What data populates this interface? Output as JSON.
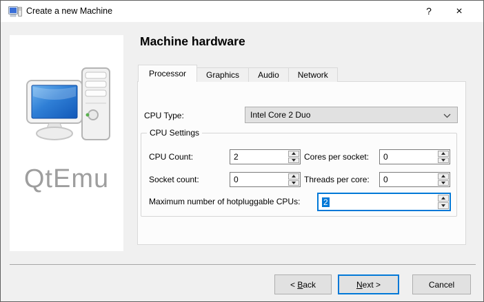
{
  "window": {
    "title": "Create a new Machine",
    "help_glyph": "?",
    "close_glyph": "×"
  },
  "sidebar": {
    "brand": "QtEmu"
  },
  "main": {
    "heading": "Machine hardware",
    "tabs": [
      {
        "label": "Processor",
        "active": true
      },
      {
        "label": "Graphics",
        "active": false
      },
      {
        "label": "Audio",
        "active": false
      },
      {
        "label": "Network",
        "active": false
      }
    ],
    "processor": {
      "cpu_type_label": "CPU Type:",
      "cpu_type_value": "Intel Core 2 Duo",
      "cpu_settings": {
        "group_label": "CPU Settings",
        "cpu_count_label": "CPU Count:",
        "cpu_count_value": "2",
        "cores_per_socket_label": "Cores per socket:",
        "cores_per_socket_value": "0",
        "socket_count_label": "Socket count:",
        "socket_count_value": "0",
        "threads_per_core_label": "Threads per core:",
        "threads_per_core_value": "0",
        "max_hotpluggable_label": "Maximum number of hotpluggable CPUs:",
        "max_hotpluggable_value": "2"
      }
    }
  },
  "footer": {
    "back": {
      "prefix": "< ",
      "accel": "B",
      "suffix": "ack"
    },
    "next": {
      "accel": "N",
      "suffix": "ext >"
    },
    "cancel_label": "Cancel"
  },
  "colors": {
    "accent": "#0078d7",
    "selection": "#0078d7",
    "titlebar_bg": "#ffffff",
    "dialog_bg": "#f0f0f0"
  }
}
